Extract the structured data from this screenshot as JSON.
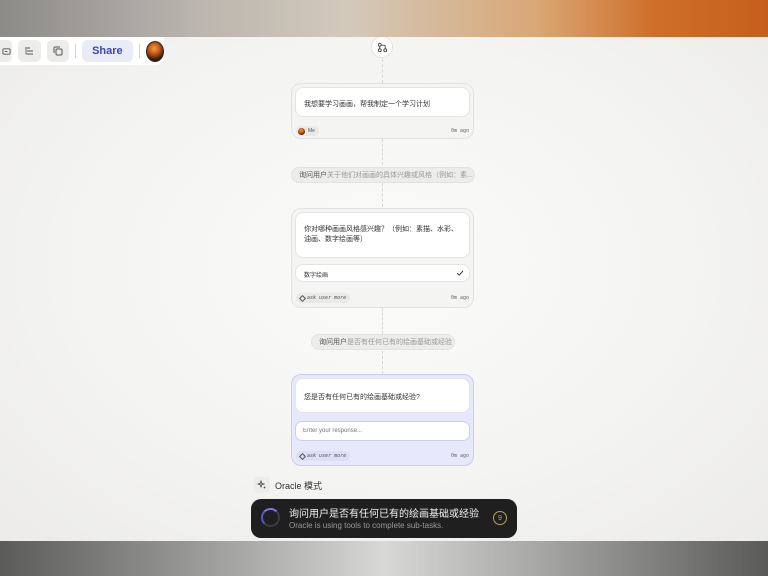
{
  "toolbar": {
    "share_label": "Share"
  },
  "icons": {
    "branch": "git-branch-icon",
    "toolbar_1": "panel-icon",
    "toolbar_2": "list-tree-icon",
    "toolbar_3": "copy-icon",
    "oracle": "sparkle-icon",
    "check": "check-icon"
  },
  "card1": {
    "message": "我想要学习画画，帮我制定一个学习计划",
    "author": "Me",
    "time": "0m ago"
  },
  "step1": {
    "action": "询问用户",
    "text": "关于他们对画画的具体兴趣或风格（例如：素..."
  },
  "card2": {
    "question": "你对哪种画画风格感兴趣？（例如：素描、水彩、油画、数字绘画等）",
    "answer": "数字绘画",
    "tag": "ask user more",
    "time": "0m ago"
  },
  "step2": {
    "action": "询问用户",
    "text": "是否有任何已有的绘画基础或经验"
  },
  "card3": {
    "question": "您是否有任何已有的绘画基础或经验?",
    "placeholder": "Enter your response...",
    "tag": "ask user more",
    "time": "0m ago"
  },
  "oracle": {
    "label": "Oracle 模式"
  },
  "status": {
    "title": "询问用户是否有任何已有的绘画基础或经验",
    "subtitle": "Oracle is using tools to complete sub-tasks.",
    "count": "9"
  },
  "colors": {
    "accent": "#3d46b8",
    "active_card": "#e6e8fb",
    "status_bg": "#1f1f20"
  }
}
